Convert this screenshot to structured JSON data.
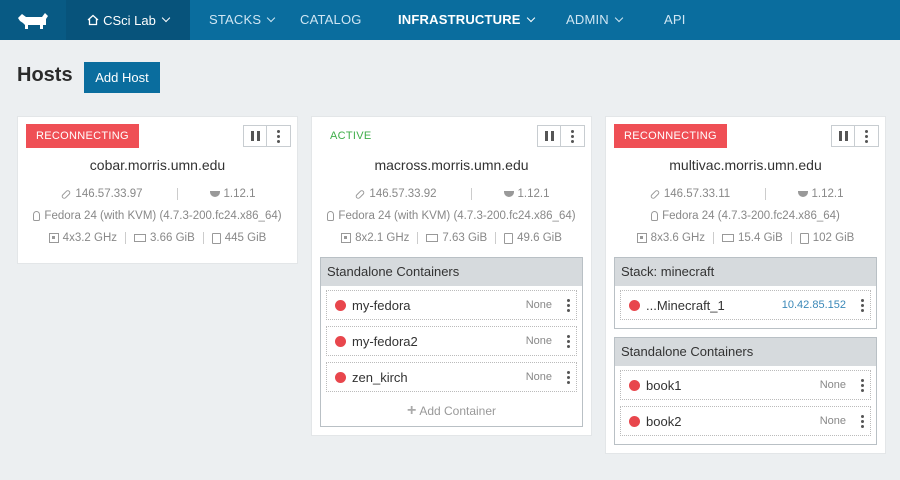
{
  "nav": {
    "environment": "CSci Lab",
    "links": [
      {
        "label": "STACKS",
        "caret": true
      },
      {
        "label": "CATALOG",
        "caret": false
      },
      {
        "label": "INFRASTRUCTURE",
        "caret": true,
        "active": true
      },
      {
        "label": "ADMIN",
        "caret": true
      },
      {
        "label": "API",
        "caret": false
      }
    ]
  },
  "page": {
    "title": "Hosts",
    "add_host_label": "Add Host"
  },
  "hosts": [
    {
      "state": "RECONNECTING",
      "name": "cobar.morris.umn.edu",
      "ip": "146.57.33.97",
      "docker": "1.12.1",
      "os": "Fedora 24 (with KVM) (4.7.3-200.fc24.x86_64)",
      "cpu": "4x3.2 GHz",
      "memory": "3.66 GiB",
      "storage": "445 GiB"
    },
    {
      "state": "ACTIVE",
      "name": "macross.morris.umn.edu",
      "ip": "146.57.33.92",
      "docker": "1.12.1",
      "os": "Fedora 24 (with KVM) (4.7.3-200.fc24.x86_64)",
      "cpu": "8x2.1 GHz",
      "memory": "7.63 GiB",
      "storage": "49.6 GiB",
      "group": {
        "title": "Standalone Containers",
        "containers": [
          {
            "name": "my-fedora",
            "port": "None"
          },
          {
            "name": "my-fedora2",
            "port": "None"
          },
          {
            "name": "zen_kirch",
            "port": "None"
          }
        ],
        "add_label": "Add Container"
      }
    },
    {
      "state": "RECONNECTING",
      "name": "multivac.morris.umn.edu",
      "ip": "146.57.33.11",
      "docker": "1.12.1",
      "os": "Fedora 24 (4.7.3-200.fc24.x86_64)",
      "cpu": "8x3.6 GHz",
      "memory": "15.4 GiB",
      "storage": "102 GiB",
      "stack": {
        "title": "Stack: minecraft",
        "containers": [
          {
            "name": "...Minecraft_1",
            "port": "10.42.85.152"
          }
        ]
      },
      "group": {
        "title": "Standalone Containers",
        "containers": [
          {
            "name": "book1",
            "port": "None"
          },
          {
            "name": "book2",
            "port": "None"
          }
        ]
      }
    }
  ],
  "colors": {
    "nav_bg": "#0a6d9e",
    "reconnecting": "#ef4f55",
    "active": "#3fae4a",
    "container_dot": "#e8464c"
  }
}
